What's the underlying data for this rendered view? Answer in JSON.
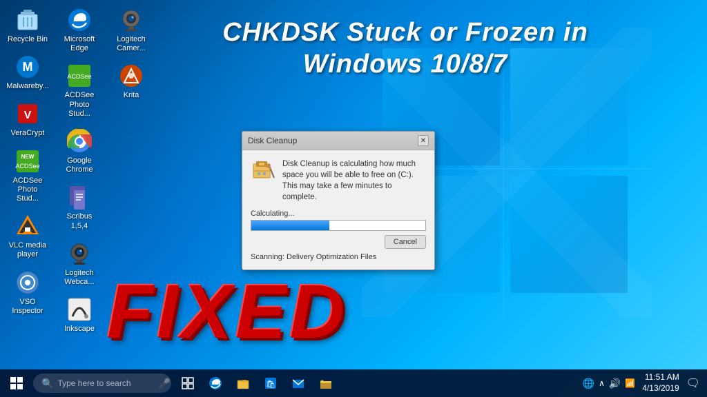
{
  "desktop": {
    "background": "windows-10-hero"
  },
  "title_overlay": {
    "line1": "CHKDSK Stuck or Frozen in",
    "line2": "Windows 10/8/7"
  },
  "fixed_text": "FIXED",
  "icons": [
    {
      "id": "recycle-bin",
      "label": "Recycle Bin",
      "icon": "🗑️",
      "color": "recycle"
    },
    {
      "id": "malwarebytes",
      "label": "Malwareby...",
      "icon": "🛡️",
      "color": "malware"
    },
    {
      "id": "veracrypt",
      "label": "VeraCrypt",
      "icon": "🔐",
      "color": "vera"
    },
    {
      "id": "acdsee-photo",
      "label": "ACDSee Photo Stud...",
      "icon": "📷",
      "color": "acdsee"
    },
    {
      "id": "vlc",
      "label": "VLC media player",
      "icon": "🎬",
      "color": "vlc"
    },
    {
      "id": "vso",
      "label": "VSO Inspector",
      "icon": "💿",
      "color": "vso"
    },
    {
      "id": "edge",
      "label": "Microsoft Edge",
      "icon": "🌐",
      "color": "edge"
    },
    {
      "id": "acdsee2",
      "label": "ACDSee Photo Stud...",
      "icon": "📷",
      "color": "acdsee2"
    },
    {
      "id": "chrome",
      "label": "Google Chrome",
      "icon": "⚪",
      "color": "chrome"
    },
    {
      "id": "scribus",
      "label": "Scribus 1,5,4",
      "icon": "📄",
      "color": "scribus"
    },
    {
      "id": "logitech-web",
      "label": "Logitech Webca...",
      "icon": "📹",
      "color": "logitech"
    },
    {
      "id": "inkscape",
      "label": "Inkscape",
      "icon": "✏️",
      "color": "inkscape"
    },
    {
      "id": "logitech-cam",
      "label": "Logitech Camer...",
      "icon": "📷",
      "color": "logitech2"
    },
    {
      "id": "krita",
      "label": "Krita",
      "icon": "🎨",
      "color": "krita"
    }
  ],
  "dialog": {
    "title": "Disk Cleanup",
    "message": "Disk Cleanup is calculating how much space you will be able to free on  (C:). This may take a few minutes to complete.",
    "progress_label": "Calculating...",
    "progress_percent": 45,
    "cancel_button": "Cancel",
    "scanning_label": "Scanning:",
    "scanning_value": "Delivery Optimization Files"
  },
  "taskbar": {
    "search_placeholder": "Type here to search",
    "time": "11:51 AM",
    "date": "4/13/2019",
    "apps": [
      "🌐",
      "📁",
      "🛒",
      "✉️",
      "📂"
    ],
    "tray_icons": [
      "⊞",
      "^",
      "🔊",
      "📶"
    ]
  }
}
